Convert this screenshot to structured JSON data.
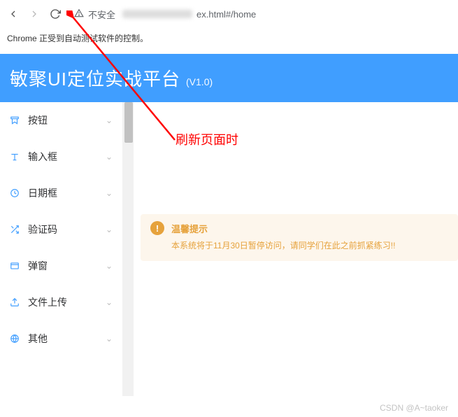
{
  "browser": {
    "security_label": "不安全",
    "url_suffix": "ex.html#/home"
  },
  "info_banner": "Chrome 正受到自动测试软件的控制。",
  "header": {
    "title": "敏聚UI定位实战平台",
    "version": "(V1.0)"
  },
  "sidebar": {
    "items": [
      {
        "label": "按钮",
        "icon": "bookmark-icon"
      },
      {
        "label": "输入框",
        "icon": "text-icon"
      },
      {
        "label": "日期框",
        "icon": "clock-icon"
      },
      {
        "label": "验证码",
        "icon": "shuffle-icon"
      },
      {
        "label": "弹窗",
        "icon": "window-icon"
      },
      {
        "label": "文件上传",
        "icon": "upload-icon"
      },
      {
        "label": "其他",
        "icon": "globe-icon"
      }
    ]
  },
  "annotation": "刷新页面时",
  "alert": {
    "title": "温馨提示",
    "message": "本系统将于11月30日暂停访问，请同学们在此之前抓紧练习!!"
  },
  "watermark": "CSDN @A~taoker"
}
